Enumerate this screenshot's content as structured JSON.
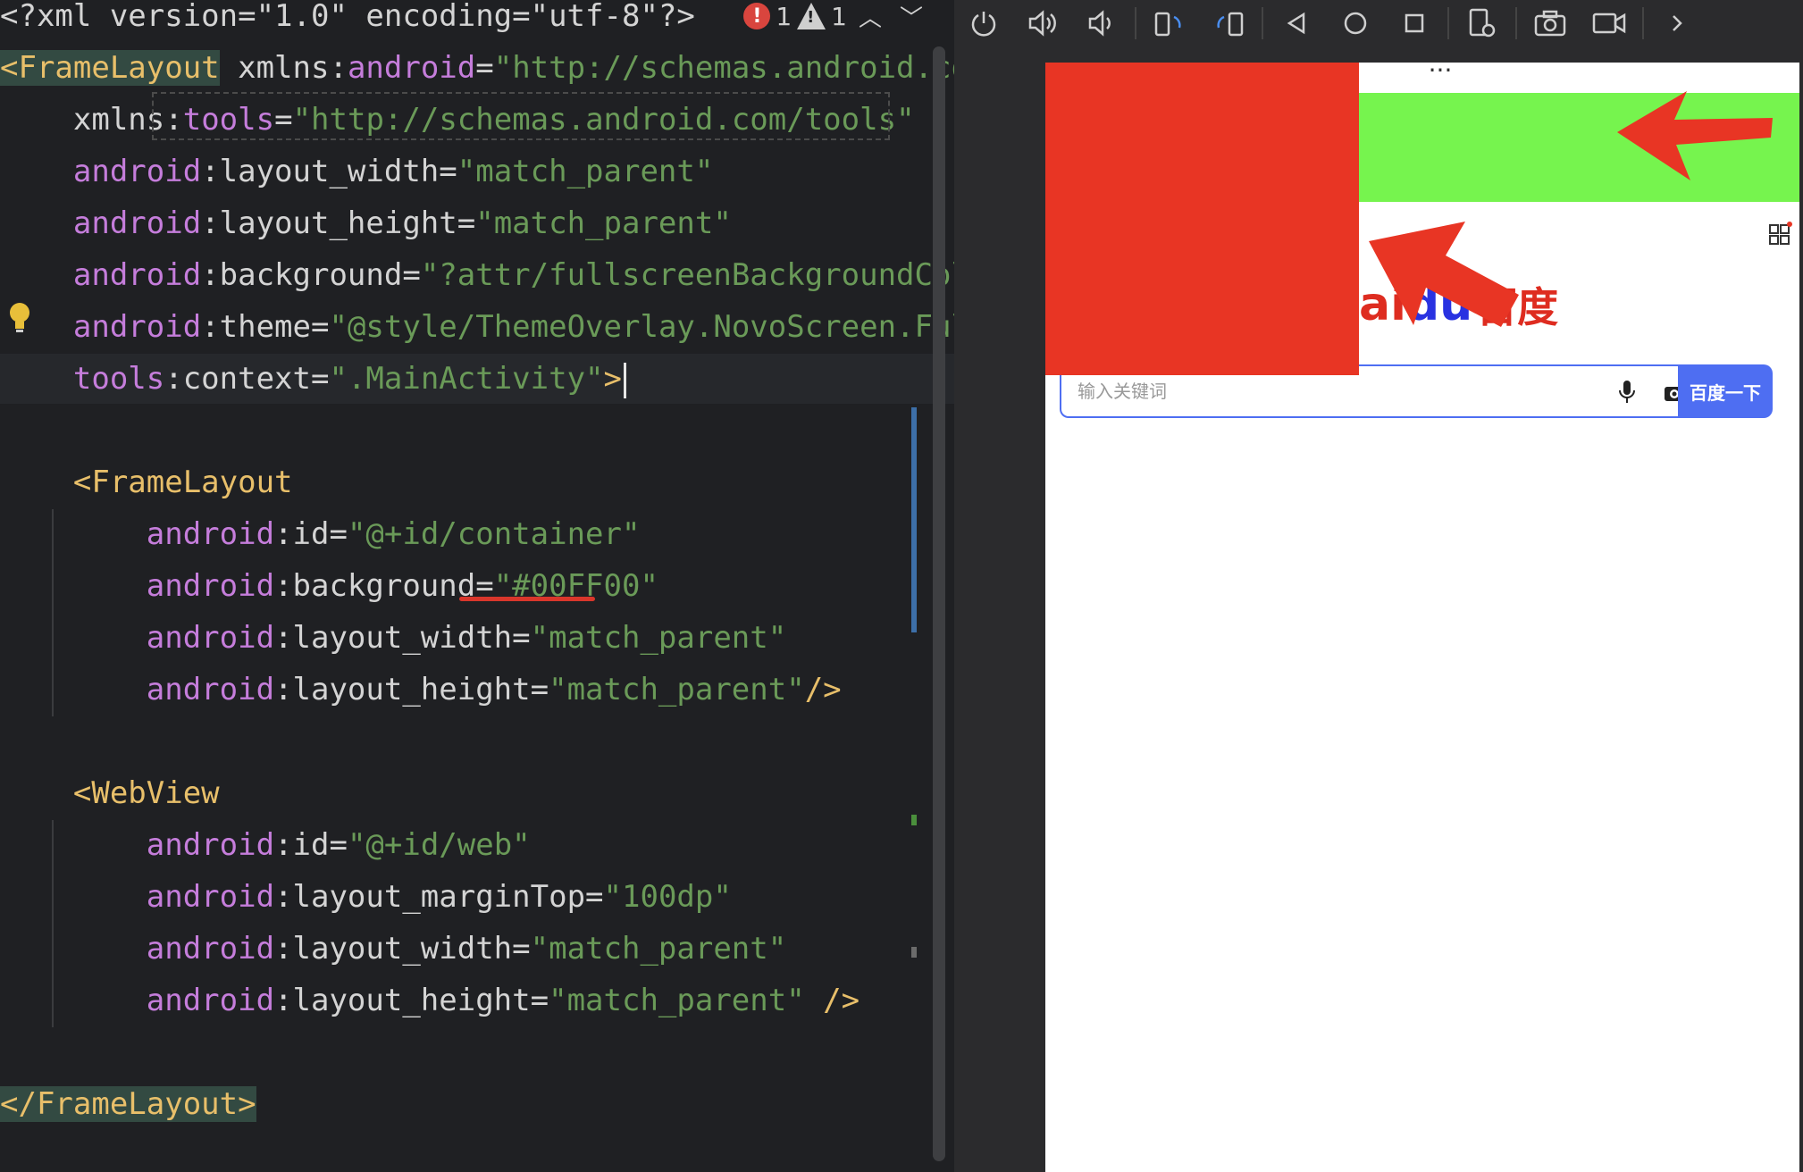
{
  "editor": {
    "lines": [
      {
        "tokens": [
          {
            "t": "<?xml version=\"1.0\" encoding=\"utf-8\"?>",
            "c": "tok-pi"
          }
        ]
      },
      {
        "tokens": [
          {
            "t": "<FrameLayout",
            "c": "tok-tag hl-block"
          },
          {
            "t": " xmlns:",
            "c": "tok-plain"
          },
          {
            "t": "android",
            "c": "tok-attr"
          },
          {
            "t": "=",
            "c": "tok-punct"
          },
          {
            "t": "\"http://schemas.android.com/ap",
            "c": "tok-str"
          }
        ]
      },
      {
        "tokens": [
          {
            "t": "    xmlns",
            "c": "tok-plain"
          },
          {
            "t": ":",
            "c": "tok-punct"
          },
          {
            "t": "tools",
            "c": "tok-attr"
          },
          {
            "t": "=",
            "c": "tok-punct"
          },
          {
            "t": "\"http://schemas.android.com/tools\"",
            "c": "tok-str"
          }
        ]
      },
      {
        "tokens": [
          {
            "t": "    android",
            "c": "tok-attr"
          },
          {
            "t": ":layout_width",
            "c": "tok-plain"
          },
          {
            "t": "=",
            "c": "tok-punct"
          },
          {
            "t": "\"match_parent\"",
            "c": "tok-str"
          }
        ]
      },
      {
        "tokens": [
          {
            "t": "    android",
            "c": "tok-attr"
          },
          {
            "t": ":layout_height",
            "c": "tok-plain"
          },
          {
            "t": "=",
            "c": "tok-punct"
          },
          {
            "t": "\"match_parent\"",
            "c": "tok-str"
          }
        ]
      },
      {
        "tokens": [
          {
            "t": "    android",
            "c": "tok-attr"
          },
          {
            "t": ":background",
            "c": "tok-plain"
          },
          {
            "t": "=",
            "c": "tok-punct"
          },
          {
            "t": "\"?attr/fullscreenBackgroundColor\"",
            "c": "tok-str"
          }
        ]
      },
      {
        "tokens": [
          {
            "t": "    android",
            "c": "tok-attr"
          },
          {
            "t": ":theme",
            "c": "tok-plain"
          },
          {
            "t": "=",
            "c": "tok-punct"
          },
          {
            "t": "\"@style/ThemeOverlay.NovoScreen.Fullsc",
            "c": "tok-str"
          }
        ]
      },
      {
        "tokens": [
          {
            "t": "    tools",
            "c": "tok-attr"
          },
          {
            "t": ":context",
            "c": "tok-plain"
          },
          {
            "t": "=",
            "c": "tok-punct"
          },
          {
            "t": "\".MainActivity\"",
            "c": "tok-str"
          },
          {
            "t": ">",
            "c": "tok-tag"
          }
        ],
        "current": true
      },
      {
        "tokens": []
      },
      {
        "tokens": [
          {
            "t": "    <FrameLayout",
            "c": "tok-tag"
          }
        ]
      },
      {
        "tokens": [
          {
            "t": "        android",
            "c": "tok-attr"
          },
          {
            "t": ":id",
            "c": "tok-plain"
          },
          {
            "t": "=",
            "c": "tok-punct"
          },
          {
            "t": "\"@+id/container\"",
            "c": "tok-str"
          }
        ]
      },
      {
        "tokens": [
          {
            "t": "        android",
            "c": "tok-attr"
          },
          {
            "t": ":background",
            "c": "tok-plain"
          },
          {
            "t": "=",
            "c": "tok-punct"
          },
          {
            "t": "\"#00FF00\"",
            "c": "tok-str"
          }
        ]
      },
      {
        "tokens": [
          {
            "t": "        android",
            "c": "tok-attr"
          },
          {
            "t": ":layout_width",
            "c": "tok-plain"
          },
          {
            "t": "=",
            "c": "tok-punct"
          },
          {
            "t": "\"match_parent\"",
            "c": "tok-str"
          }
        ]
      },
      {
        "tokens": [
          {
            "t": "        android",
            "c": "tok-attr"
          },
          {
            "t": ":layout_height",
            "c": "tok-plain"
          },
          {
            "t": "=",
            "c": "tok-punct"
          },
          {
            "t": "\"match_parent\"",
            "c": "tok-str"
          },
          {
            "t": "/>",
            "c": "tok-tag"
          }
        ]
      },
      {
        "tokens": []
      },
      {
        "tokens": [
          {
            "t": "    <WebView",
            "c": "tok-tag"
          }
        ]
      },
      {
        "tokens": [
          {
            "t": "        android",
            "c": "tok-attr"
          },
          {
            "t": ":id",
            "c": "tok-plain"
          },
          {
            "t": "=",
            "c": "tok-punct"
          },
          {
            "t": "\"@+id/web\"",
            "c": "tok-str"
          }
        ]
      },
      {
        "tokens": [
          {
            "t": "        android",
            "c": "tok-attr"
          },
          {
            "t": ":layout_marginTop",
            "c": "tok-plain"
          },
          {
            "t": "=",
            "c": "tok-punct"
          },
          {
            "t": "\"100dp\"",
            "c": "tok-str"
          }
        ]
      },
      {
        "tokens": [
          {
            "t": "        android",
            "c": "tok-attr"
          },
          {
            "t": ":layout_width",
            "c": "tok-plain"
          },
          {
            "t": "=",
            "c": "tok-punct"
          },
          {
            "t": "\"match_parent\"",
            "c": "tok-str"
          }
        ]
      },
      {
        "tokens": [
          {
            "t": "        android",
            "c": "tok-attr"
          },
          {
            "t": ":layout_height",
            "c": "tok-plain"
          },
          {
            "t": "=",
            "c": "tok-punct"
          },
          {
            "t": "\"match_parent\"",
            "c": "tok-str"
          },
          {
            "t": " />",
            "c": "tok-tag"
          }
        ]
      },
      {
        "tokens": []
      },
      {
        "tokens": [
          {
            "t": "</FrameLayout>",
            "c": "tok-tag hl-block"
          }
        ]
      }
    ],
    "inspections": {
      "errors": "1",
      "warnings": "1"
    }
  },
  "phone": {
    "logo_left": "ai",
    "logo_paw": "du",
    "logo_right": "百度",
    "search_placeholder": "输入关键词",
    "search_button": "百度一下",
    "green_color": "#76f44e",
    "red_color": "#e83524"
  },
  "toolbar": {
    "icons": [
      "power-icon",
      "volume-up-icon",
      "volume-down-icon",
      "rotate-left-icon",
      "rotate-right-icon",
      "back-icon",
      "home-icon",
      "overview-icon",
      "device-settings-icon",
      "screenshot-icon",
      "screen-record-icon",
      "more-icon"
    ]
  }
}
